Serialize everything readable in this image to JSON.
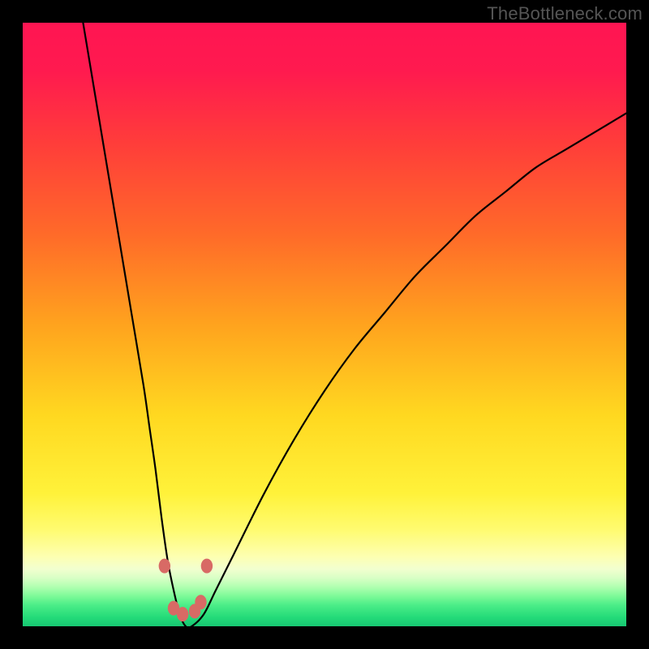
{
  "watermark": "TheBottleneck.com",
  "gradient": {
    "stops": [
      {
        "offset": 0.0,
        "color": "#ff1552"
      },
      {
        "offset": 0.08,
        "color": "#ff1a4f"
      },
      {
        "offset": 0.2,
        "color": "#ff3d3a"
      },
      {
        "offset": 0.35,
        "color": "#ff6a29"
      },
      {
        "offset": 0.5,
        "color": "#ffa31e"
      },
      {
        "offset": 0.65,
        "color": "#ffd820"
      },
      {
        "offset": 0.78,
        "color": "#fff23a"
      },
      {
        "offset": 0.84,
        "color": "#fffb70"
      },
      {
        "offset": 0.885,
        "color": "#fdffb2"
      },
      {
        "offset": 0.905,
        "color": "#f2ffcf"
      },
      {
        "offset": 0.92,
        "color": "#d8ffc5"
      },
      {
        "offset": 0.935,
        "color": "#b0ffb0"
      },
      {
        "offset": 0.95,
        "color": "#7dfa98"
      },
      {
        "offset": 0.965,
        "color": "#4bed88"
      },
      {
        "offset": 0.985,
        "color": "#24db79"
      },
      {
        "offset": 1.0,
        "color": "#17c772"
      }
    ]
  },
  "chart_data": {
    "type": "line",
    "title": "",
    "xlabel": "",
    "ylabel": "",
    "xlim": [
      0,
      100
    ],
    "ylim": [
      0,
      100
    ],
    "series": [
      {
        "name": "bottleneck-curve",
        "x": [
          10,
          12,
          14,
          16,
          18,
          20,
          21,
          22,
          23,
          24,
          25,
          26,
          27,
          28,
          30,
          32,
          35,
          40,
          45,
          50,
          55,
          60,
          65,
          70,
          75,
          80,
          85,
          90,
          95,
          100
        ],
        "y": [
          100,
          88,
          76,
          64,
          52,
          40,
          33,
          26,
          18,
          11,
          6,
          2,
          0,
          0,
          2,
          6,
          12,
          22,
          31,
          39,
          46,
          52,
          58,
          63,
          68,
          72,
          76,
          79,
          82,
          85
        ]
      }
    ],
    "markers": [
      {
        "x": 23.5,
        "y": 10
      },
      {
        "x": 30.5,
        "y": 10
      },
      {
        "x": 25,
        "y": 3
      },
      {
        "x": 26.5,
        "y": 2
      },
      {
        "x": 28.5,
        "y": 2.5
      },
      {
        "x": 29.5,
        "y": 4
      }
    ],
    "marker_radius_px": 9
  }
}
